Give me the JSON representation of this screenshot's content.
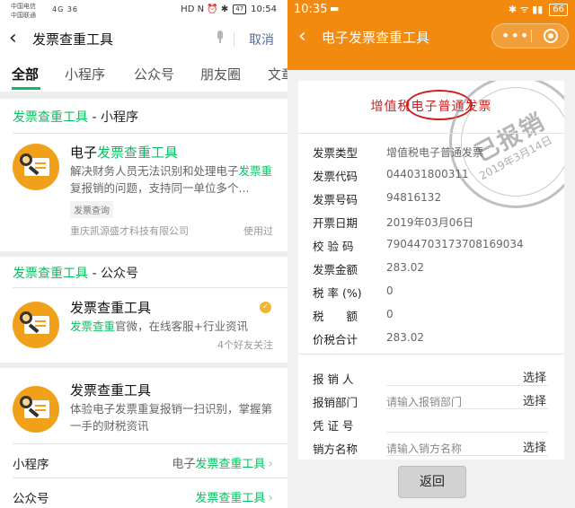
{
  "left": {
    "status_bar": {
      "carrier_1": "中国电信",
      "carrier_2": "中国联通",
      "signal": "4G 36",
      "icons": "HD N ⏰ ✱",
      "battery": "47",
      "time": "10:54"
    },
    "search": {
      "query": "发票查重工具",
      "cancel": "取消"
    },
    "tabs": [
      "全部",
      "小程序",
      "公众号",
      "朋友圈",
      "文章"
    ],
    "mini_section": {
      "title_highlight": "发票查重工具",
      "title_suffix": " - 小程序",
      "item": {
        "title_prefix": "电子",
        "title_highlight": "发票查重工具",
        "desc_1": "解决财务人员无法识别和处理电子",
        "desc_hl_1": "发票",
        "desc_hl_2": "重",
        "desc_2": "复报销的问题，支持同一单位多个...",
        "tag": "发票查询",
        "company": "重庆凯源盛才科技有限公司",
        "used": "使用过"
      }
    },
    "oa_section": {
      "title_highlight": "发票查重工具",
      "title_suffix": " - 公众号",
      "item1": {
        "title": "发票查重工具",
        "desc_hl": "发票查重",
        "desc": "官微，在线客服+行业资讯",
        "verified": "✓",
        "friends": "4个好友关注"
      },
      "item2": {
        "title": "发票查重工具",
        "desc": "体验电子发票重复报销一扫识别，掌握第一手的财税资讯"
      }
    },
    "rows": [
      {
        "label": "小程序",
        "value_prefix": "电子",
        "value_highlight": "发票查重工具"
      },
      {
        "label": "公众号",
        "value_prefix": "",
        "value_highlight": "发票查重工具"
      }
    ]
  },
  "right": {
    "status_bar": {
      "time": "10:35",
      "small": "▬",
      "icons": "✱ ᯤ ▮▮",
      "battery": "66"
    },
    "nav": {
      "title": "电子发票查重工具",
      "more": "•••"
    },
    "invoice": {
      "title": "增值税电子普通发票",
      "stamp_text": "已报销",
      "stamp_date": "2019年3月14日",
      "fields": [
        {
          "label": "发票类型",
          "value": "增值税电子普通发票"
        },
        {
          "label": "发票代码",
          "value": "044031800311"
        },
        {
          "label": "发票号码",
          "value": "94816132"
        },
        {
          "label": "开票日期",
          "value": "2019年03月06日"
        },
        {
          "label": "校 验 码",
          "value": "79044703173708169034"
        },
        {
          "label": "发票金额",
          "value": "283.02"
        },
        {
          "label": "税 率 (%)",
          "value": "0"
        },
        {
          "label": "税　　额",
          "value": "0"
        },
        {
          "label": "价税合计",
          "value": "283.02"
        }
      ],
      "reimb_fields": [
        {
          "label": "报 销 人",
          "placeholder": "",
          "action": "选择"
        },
        {
          "label": "报销部门",
          "placeholder": "请输入报销部门",
          "action": "选择"
        },
        {
          "label": "凭 证 号",
          "placeholder": "",
          "action": ""
        },
        {
          "label": "销方名称",
          "placeholder": "请输入销方名称",
          "action": "选择"
        }
      ]
    },
    "back_button": "返回"
  }
}
